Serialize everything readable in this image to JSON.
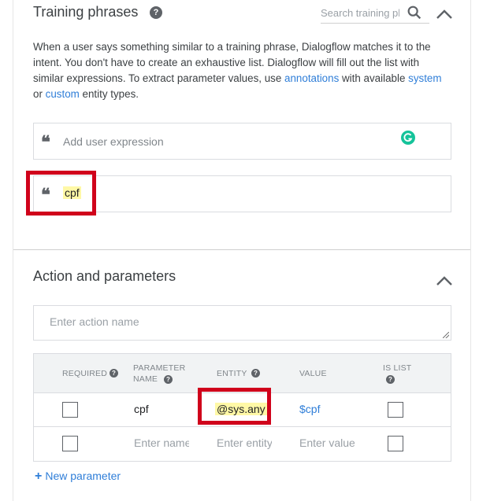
{
  "training": {
    "title": "Training phrases",
    "search_placeholder": "Search training phrases",
    "description_part1": "When a user says something similar to a training phrase, Dialogflow matches it to the intent. You don't have to create an exhaustive list. Dialogflow will fill out the list with similar expressions. To extract parameter values, use ",
    "link_annotations": "annotations",
    "description_part2": " with available ",
    "link_system": "system",
    "description_part3": " or ",
    "link_custom": "custom",
    "description_part4": " entity types.",
    "add_placeholder": "Add user expression",
    "phrases": [
      "cpf"
    ]
  },
  "action": {
    "title": "Action and parameters",
    "action_placeholder": "Enter action name"
  },
  "params": {
    "headers": {
      "required": "REQUIRED",
      "param_name_1": "PARAMETER",
      "param_name_2": "NAME",
      "entity": "ENTITY",
      "value": "VALUE",
      "is_list_1": "IS LIST"
    },
    "rows": [
      {
        "name": "cpf",
        "entity": "@sys.any",
        "value": "$cpf"
      }
    ],
    "placeholders": {
      "name": "Enter name",
      "entity": "Enter entity",
      "value": "Enter value"
    },
    "new_param_label": "New parameter"
  },
  "colors": {
    "highlight_box": "#d0021b",
    "link": "#2f7ed8",
    "annotation_highlight": "#fff8a6"
  }
}
